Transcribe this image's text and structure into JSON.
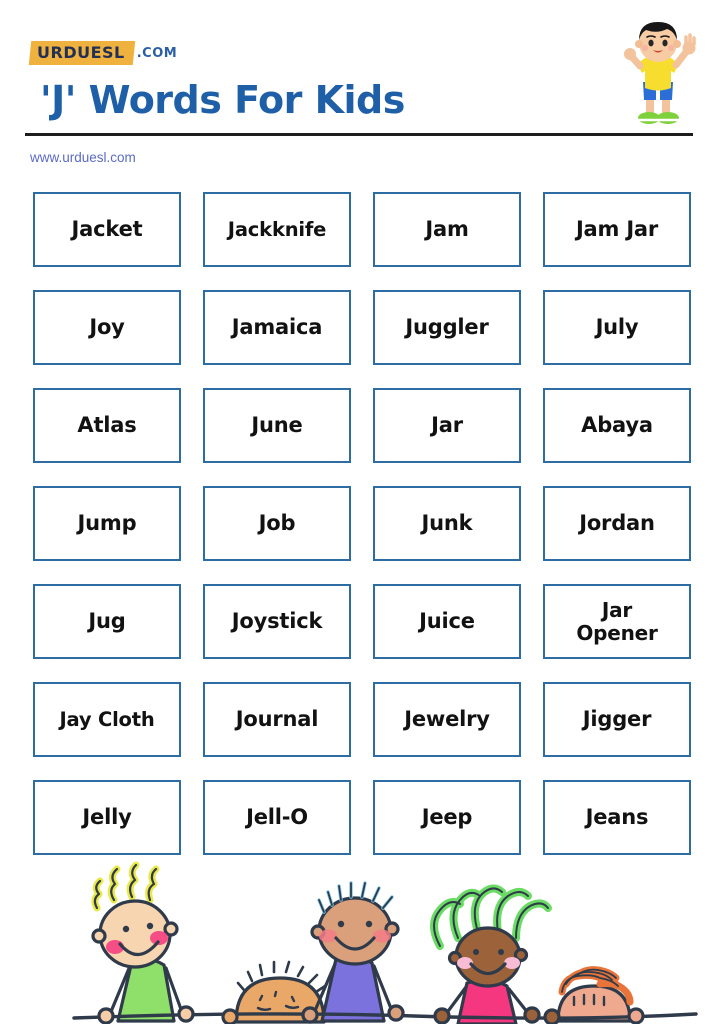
{
  "header": {
    "logo_badge_text": "URDUESL",
    "logo_dotcom_text": ".COM",
    "title": "'J' Words For Kids",
    "site_url": "www.urduesl.com",
    "mascot_alt": "waving-boy-illustration"
  },
  "colors": {
    "title_blue": "#1F5FA8",
    "box_border_blue": "#2E6DA4",
    "logo_badge_yellow": "#F0B23F",
    "logo_text_navy": "#223055",
    "url_blue": "#5C6BC8",
    "rule_black": "#1D1D1D",
    "word_text": "#121212",
    "page_background": "#FFFFFF"
  },
  "grid": {
    "columns": 4,
    "rows": 7,
    "words": [
      "Jacket",
      "Jackknife",
      "Jam",
      "Jam Jar",
      "Joy",
      "Jamaica",
      "Juggler",
      "July",
      "Atlas",
      "June",
      "Jar",
      "Abaya",
      "Jump",
      "Job",
      "Junk",
      "Jordan",
      "Jug",
      "Joystick",
      "Juice",
      "Jar\nOpener",
      "Jay Cloth",
      "Journal",
      "Jewelry",
      "Jigger",
      "Jelly",
      "Jell-O",
      "Jeep",
      "Jeans"
    ]
  },
  "footer": {
    "alt": "four-children-peeking-over-line-illustration",
    "kids": [
      {
        "name": "kid-yellow-hair",
        "hair": "#E9E94A",
        "skin": "#F5CDA7",
        "shirt": "#8FE06A"
      },
      {
        "name": "kid-spiky-tan-hair",
        "hair": "#E39E59",
        "skin": "#E9A867",
        "shirt": ""
      },
      {
        "name": "kid-blue-spiky-hair",
        "hair": "#7EC8E8",
        "skin": "#D9A07B",
        "shirt": "#7B72DE"
      },
      {
        "name": "kid-green-curly-hair",
        "hair": "#6ADB63",
        "skin": "#9C6239",
        "shirt": "#F4377F"
      },
      {
        "name": "kid-orange-hair",
        "hair": "#E8743A",
        "skin": "#EFA98F",
        "shirt": ""
      }
    ]
  }
}
